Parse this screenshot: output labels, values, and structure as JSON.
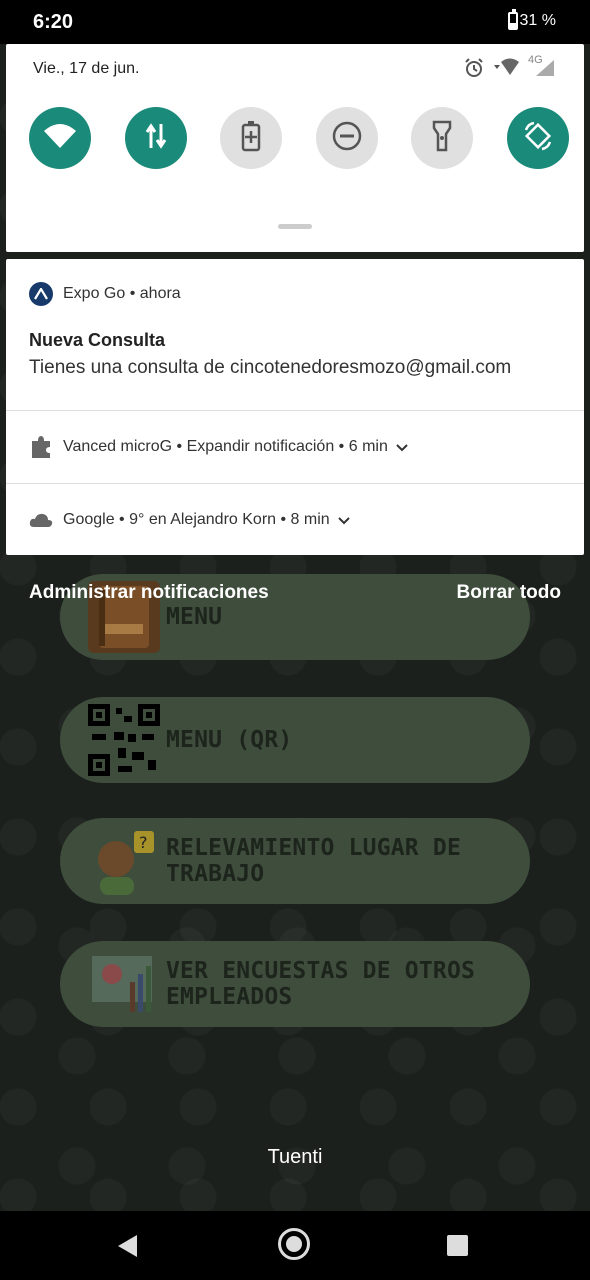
{
  "status_bar": {
    "time": "6:20",
    "battery": "31 %"
  },
  "quick_settings": {
    "date": "Vie., 17 de jun.",
    "network_label": "4G",
    "tiles": [
      {
        "icon": "wifi-icon",
        "active": true
      },
      {
        "icon": "mobile-data-icon",
        "active": true
      },
      {
        "icon": "battery-saver-icon",
        "active": false
      },
      {
        "icon": "do-not-disturb-icon",
        "active": false
      },
      {
        "icon": "flashlight-icon",
        "active": false
      },
      {
        "icon": "auto-rotate-icon",
        "active": true
      }
    ],
    "accent_color": "#1a8a7a"
  },
  "notifications": [
    {
      "app": "Expo Go",
      "time": "ahora",
      "title": "Nueva Consulta",
      "body": "Tienes una consulta de cincotenedoresmozo@gmail.com"
    },
    {
      "app": "Vanced microG",
      "text": "Expandir notificación",
      "time": "6 min"
    },
    {
      "app": "Google",
      "text": "9° en Alejandro Korn",
      "time": "8 min"
    }
  ],
  "actions": {
    "manage": "Administrar notificaciones",
    "clear_all": "Borrar todo"
  },
  "app": {
    "buttons": [
      {
        "label": "MENU",
        "icon": "menu-book-icon"
      },
      {
        "label": "MENU (QR)",
        "icon": "qr-code-icon"
      },
      {
        "label": "RELEVAMIENTO LUGAR DE TRABAJO",
        "icon": "question-person-icon"
      },
      {
        "label": "VER ENCUESTAS DE OTROS EMPLEADOS",
        "icon": "chart-board-icon"
      }
    ],
    "carrier": "Tuenti"
  }
}
